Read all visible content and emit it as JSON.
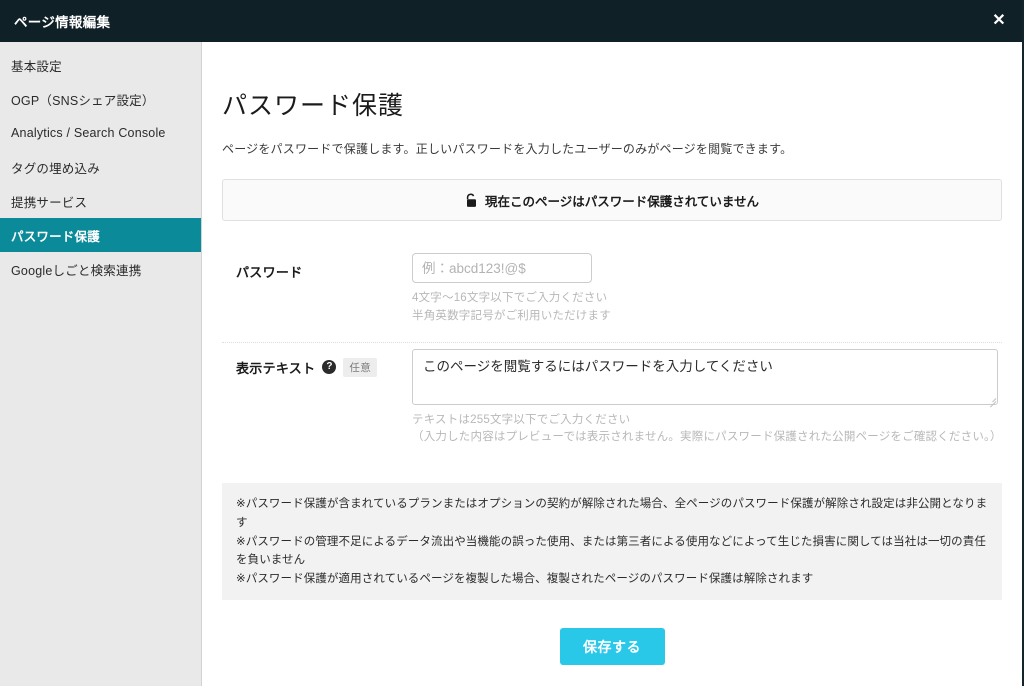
{
  "header": {
    "title": "ページ情報編集",
    "close_label": "✕"
  },
  "sidebar": {
    "items": [
      {
        "label": "基本設定",
        "active": false
      },
      {
        "label": "OGP（SNSシェア設定）",
        "active": false
      },
      {
        "label": "Analytics / Search Console",
        "active": false
      },
      {
        "label": "タグの埋め込み",
        "active": false
      },
      {
        "label": "提携サービス",
        "active": false
      },
      {
        "label": "パスワード保護",
        "active": true
      },
      {
        "label": "Googleしごと検索連携",
        "active": false
      }
    ]
  },
  "main": {
    "page_title": "パスワード保護",
    "description": "ページをパスワードで保護します。正しいパスワードを入力したユーザーのみがページを閲覧できます。",
    "status_banner": {
      "icon": "unlock-icon",
      "text": "現在このページはパスワード保護されていません"
    },
    "password_field": {
      "label": "パスワード",
      "value": "",
      "placeholder": "例：abcd123!@$",
      "hint_line1": "4文字〜16文字以下でご入力ください",
      "hint_line2": "半角英数字記号がご利用いただけます"
    },
    "display_text_field": {
      "label": "表示テキスト",
      "help_icon": "?",
      "optional_badge": "任意",
      "value": "このページを閲覧するにはパスワードを入力してください",
      "hint_line1": "テキストは255文字以下でご入力ください",
      "hint_line2": "（入力した内容はプレビューでは表示されません。実際にパスワード保護された公開ページをご確認ください。）"
    },
    "notices": [
      "※パスワード保護が含まれているプランまたはオプションの契約が解除された場合、全ページのパスワード保護が解除され設定は非公開となります",
      "※パスワードの管理不足によるデータ流出や当機能の誤った使用、または第三者による使用などによって生じた損害に関しては当社は一切の責任を負いません",
      "※パスワード保護が適用されているページを複製した場合、複製されたページのパスワード保護は解除されます"
    ],
    "save_button": "保存する"
  },
  "colors": {
    "header_bg": "#0f2027",
    "sidebar_active": "#0b8a99",
    "save_button": "#29c7e8"
  }
}
